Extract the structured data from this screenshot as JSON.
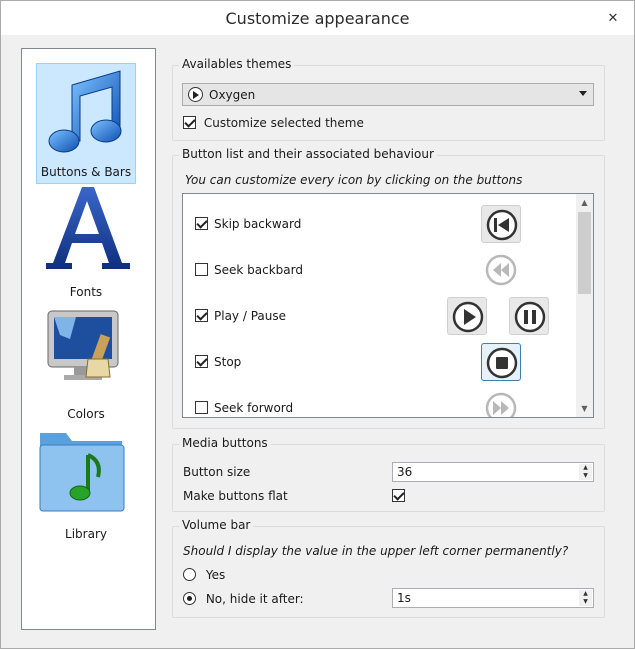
{
  "window": {
    "title": "Customize appearance",
    "close_glyph": "✕"
  },
  "sidebar": {
    "items": [
      {
        "label": "Buttons & Bars",
        "icon": "music-note-icon",
        "selected": true
      },
      {
        "label": "Fonts",
        "icon": "font-letter-a-icon",
        "selected": false
      },
      {
        "label": "Colors",
        "icon": "monitor-paintbrush-icon",
        "selected": false
      },
      {
        "label": "Library",
        "icon": "music-folder-icon",
        "selected": false
      }
    ]
  },
  "themes": {
    "group_title": "Availables themes",
    "selected_theme": "Oxygen",
    "customize_label": "Customize selected theme",
    "customize_checked": true
  },
  "button_list": {
    "group_title": "Button list and their associated behaviour",
    "hint": "You can customize every icon by clicking on the buttons",
    "rows": [
      {
        "label": "Skip backward",
        "checked": true,
        "buttons": [
          "skip-backward-icon"
        ]
      },
      {
        "label": "Seek backbard",
        "checked": false,
        "buttons": [
          "seek-backward-icon"
        ]
      },
      {
        "label": "Play / Pause",
        "checked": true,
        "buttons": [
          "play-icon",
          "pause-icon"
        ]
      },
      {
        "label": "Stop",
        "checked": true,
        "buttons": [
          "stop-icon"
        ]
      },
      {
        "label": "Seek forword",
        "checked": false,
        "buttons": [
          "seek-forward-icon"
        ]
      }
    ]
  },
  "media_buttons": {
    "group_title": "Media buttons",
    "size_label": "Button size",
    "size_value": "36",
    "flat_label": "Make buttons flat",
    "flat_checked": true
  },
  "volume_bar": {
    "group_title": "Volume bar",
    "question": "Should I display the value in the upper left corner permanently?",
    "yes_label": "Yes",
    "no_label": "No, hide it after:",
    "hide_after_value": "1s",
    "selected": "no"
  },
  "colors": {
    "accent": "#1e6fd8",
    "selection_bg": "#cce8ff",
    "selection_border": "#99d1ff"
  }
}
